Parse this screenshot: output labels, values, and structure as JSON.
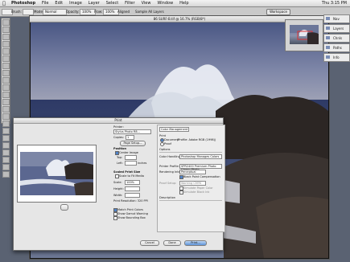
{
  "menubar": {
    "app": "Photoshop",
    "items": [
      "File",
      "Edit",
      "Image",
      "Layer",
      "Select",
      "Filter",
      "View",
      "Window",
      "Help"
    ],
    "clock": "Thu 3:15 PM"
  },
  "options_bar": {
    "brush_label": "Brush:",
    "mode_label": "Mode:",
    "mode_value": "Normal",
    "opacity_label": "Opacity:",
    "opacity_value": "100%",
    "flow_label": "Flow:",
    "flow_value": "100%",
    "aligned_label": "Aligned",
    "sample_label": "Sample All Layers",
    "workspace_label": "Workspace"
  },
  "document": {
    "title": "86 SURF-B.tif @ 16.7% (RGB/8*)"
  },
  "palettes": [
    "Nav",
    "Layers",
    "Chnls",
    "Paths",
    "Info"
  ],
  "print_dialog": {
    "title": "Print",
    "printer_label": "Printer:",
    "printer_value": "Stylus Photo R8...",
    "copies_label": "Copies:",
    "copies_value": "1",
    "page_setup": "Page Setup...",
    "position_label": "Position",
    "center_image": "Center Image",
    "top_label": "Top:",
    "left_label": "Left:",
    "units_label": "inches",
    "scaled_label": "Scaled Print Size",
    "scale_to_fit": "Scale to Fit Media",
    "scale_label": "Scale:",
    "scale_value": "100%",
    "height_label": "Height:",
    "width_label": "Width:",
    "resolution": "Print Resolution: 320 PPI",
    "match_colors": "Match Print Colors",
    "gamut_warning": "Show Gamut Warning",
    "show_bbox": "Show Bounding Box",
    "color_mgmt": "Color Management",
    "print_label": "Print",
    "document_opt": "Document",
    "proof_opt": "Proof",
    "document_profile": "(Profile: Adobe RGB (1998))",
    "options_label": "Options",
    "color_handling_label": "Color Handling:",
    "color_handling_value": "Photoshop Manages Colors",
    "printer_profile_label": "Printer Profile:",
    "printer_profile_value": "SPR2400 Premium Photo Glossy Photo",
    "rendering_label": "Rendering Intent:",
    "rendering_value": "Perceptual",
    "bpc_label": "Black Point Compensation",
    "proof_setup_label": "Proof Setup:",
    "proof_setup_value": "Working CMYK",
    "simulate_paper": "Simulate Paper Color",
    "simulate_ink": "Simulate Black Ink",
    "description_label": "Description",
    "cancel": "Cancel",
    "done": "Done",
    "print_btn": "Print..."
  }
}
